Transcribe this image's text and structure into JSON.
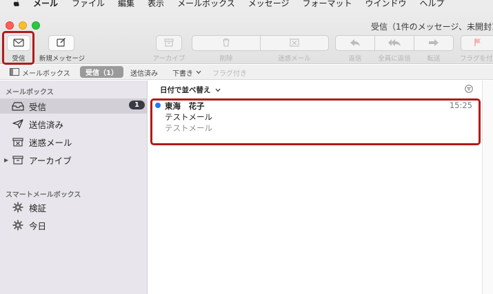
{
  "menubar": {
    "items": [
      "メール",
      "ファイル",
      "編集",
      "表示",
      "メールボックス",
      "メッセージ",
      "フォーマット",
      "ウインドウ",
      "ヘルプ"
    ]
  },
  "window": {
    "title": "受信（1件のメッセージ、未開封1"
  },
  "toolbar": {
    "inbox_label": "受信",
    "compose_label": "新規メッセージ",
    "archive_label": "アーカイブ",
    "delete_label": "削除",
    "junk_label": "迷惑メール",
    "reply_label": "返信",
    "reply_all_label": "全員に返信",
    "forward_label": "転送",
    "flag_label": "フラグを付"
  },
  "favorites": {
    "mailboxes": "メールボックス",
    "inbox": "受信（1）",
    "sent": "送信済み",
    "drafts": "下書き",
    "flagged": "フラグ付き"
  },
  "sidebar": {
    "mailboxes_header": "メールボックス",
    "smart_header": "スマートメールボックス",
    "items": [
      {
        "label": "受信",
        "icon": "inbox-tray-icon",
        "badge": "1"
      },
      {
        "label": "送信済み",
        "icon": "paper-plane-icon"
      },
      {
        "label": "迷惑メール",
        "icon": "junk-box-icon"
      },
      {
        "label": "アーカイブ",
        "icon": "archive-box-icon"
      }
    ],
    "smart_items": [
      {
        "label": "検証",
        "icon": "gear-icon"
      },
      {
        "label": "今日",
        "icon": "gear-icon"
      }
    ]
  },
  "list": {
    "sort_label": "日付で並べ替え",
    "messages": [
      {
        "from": "東海　花子",
        "time": "15:25",
        "subject": "テストメール",
        "preview": "テストメール",
        "unread": true
      }
    ]
  },
  "colors": {
    "highlight": "#b11a1a",
    "unread_dot": "#1b7cf5",
    "sidebar_bg": "#e8e6ec",
    "badge_bg": "#3a3a44"
  }
}
